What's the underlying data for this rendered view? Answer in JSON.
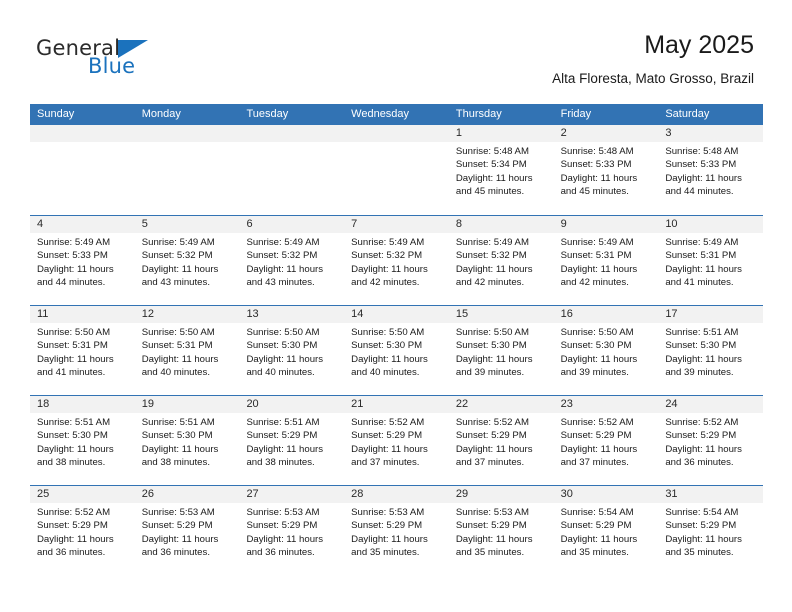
{
  "brand": {
    "word_general": "General",
    "word_blue": "Blue",
    "flag_icon": "triangle-flag-icon",
    "accent_color": "#1b72bd"
  },
  "header": {
    "title": "May 2025",
    "subtitle": "Alta Floresta, Mato Grosso, Brazil"
  },
  "calendar": {
    "header_bg": "#3273b4",
    "daynum_bg": "#f2f2f2",
    "weekday_headers": [
      "Sunday",
      "Monday",
      "Tuesday",
      "Wednesday",
      "Thursday",
      "Friday",
      "Saturday"
    ],
    "weeks": [
      [
        {
          "day": "",
          "empty": true,
          "sunrise": "",
          "sunset": "",
          "daylight_line1": "",
          "daylight_line2": ""
        },
        {
          "day": "",
          "empty": true,
          "sunrise": "",
          "sunset": "",
          "daylight_line1": "",
          "daylight_line2": ""
        },
        {
          "day": "",
          "empty": true,
          "sunrise": "",
          "sunset": "",
          "daylight_line1": "",
          "daylight_line2": ""
        },
        {
          "day": "",
          "empty": true,
          "sunrise": "",
          "sunset": "",
          "daylight_line1": "",
          "daylight_line2": ""
        },
        {
          "day": "1",
          "sunrise": "Sunrise: 5:48 AM",
          "sunset": "Sunset: 5:34 PM",
          "daylight_line1": "Daylight: 11 hours",
          "daylight_line2": "and 45 minutes."
        },
        {
          "day": "2",
          "sunrise": "Sunrise: 5:48 AM",
          "sunset": "Sunset: 5:33 PM",
          "daylight_line1": "Daylight: 11 hours",
          "daylight_line2": "and 45 minutes."
        },
        {
          "day": "3",
          "sunrise": "Sunrise: 5:48 AM",
          "sunset": "Sunset: 5:33 PM",
          "daylight_line1": "Daylight: 11 hours",
          "daylight_line2": "and 44 minutes."
        }
      ],
      [
        {
          "day": "4",
          "sunrise": "Sunrise: 5:49 AM",
          "sunset": "Sunset: 5:33 PM",
          "daylight_line1": "Daylight: 11 hours",
          "daylight_line2": "and 44 minutes."
        },
        {
          "day": "5",
          "sunrise": "Sunrise: 5:49 AM",
          "sunset": "Sunset: 5:32 PM",
          "daylight_line1": "Daylight: 11 hours",
          "daylight_line2": "and 43 minutes."
        },
        {
          "day": "6",
          "sunrise": "Sunrise: 5:49 AM",
          "sunset": "Sunset: 5:32 PM",
          "daylight_line1": "Daylight: 11 hours",
          "daylight_line2": "and 43 minutes."
        },
        {
          "day": "7",
          "sunrise": "Sunrise: 5:49 AM",
          "sunset": "Sunset: 5:32 PM",
          "daylight_line1": "Daylight: 11 hours",
          "daylight_line2": "and 42 minutes."
        },
        {
          "day": "8",
          "sunrise": "Sunrise: 5:49 AM",
          "sunset": "Sunset: 5:32 PM",
          "daylight_line1": "Daylight: 11 hours",
          "daylight_line2": "and 42 minutes."
        },
        {
          "day": "9",
          "sunrise": "Sunrise: 5:49 AM",
          "sunset": "Sunset: 5:31 PM",
          "daylight_line1": "Daylight: 11 hours",
          "daylight_line2": "and 42 minutes."
        },
        {
          "day": "10",
          "sunrise": "Sunrise: 5:49 AM",
          "sunset": "Sunset: 5:31 PM",
          "daylight_line1": "Daylight: 11 hours",
          "daylight_line2": "and 41 minutes."
        }
      ],
      [
        {
          "day": "11",
          "sunrise": "Sunrise: 5:50 AM",
          "sunset": "Sunset: 5:31 PM",
          "daylight_line1": "Daylight: 11 hours",
          "daylight_line2": "and 41 minutes."
        },
        {
          "day": "12",
          "sunrise": "Sunrise: 5:50 AM",
          "sunset": "Sunset: 5:31 PM",
          "daylight_line1": "Daylight: 11 hours",
          "daylight_line2": "and 40 minutes."
        },
        {
          "day": "13",
          "sunrise": "Sunrise: 5:50 AM",
          "sunset": "Sunset: 5:30 PM",
          "daylight_line1": "Daylight: 11 hours",
          "daylight_line2": "and 40 minutes."
        },
        {
          "day": "14",
          "sunrise": "Sunrise: 5:50 AM",
          "sunset": "Sunset: 5:30 PM",
          "daylight_line1": "Daylight: 11 hours",
          "daylight_line2": "and 40 minutes."
        },
        {
          "day": "15",
          "sunrise": "Sunrise: 5:50 AM",
          "sunset": "Sunset: 5:30 PM",
          "daylight_line1": "Daylight: 11 hours",
          "daylight_line2": "and 39 minutes."
        },
        {
          "day": "16",
          "sunrise": "Sunrise: 5:50 AM",
          "sunset": "Sunset: 5:30 PM",
          "daylight_line1": "Daylight: 11 hours",
          "daylight_line2": "and 39 minutes."
        },
        {
          "day": "17",
          "sunrise": "Sunrise: 5:51 AM",
          "sunset": "Sunset: 5:30 PM",
          "daylight_line1": "Daylight: 11 hours",
          "daylight_line2": "and 39 minutes."
        }
      ],
      [
        {
          "day": "18",
          "sunrise": "Sunrise: 5:51 AM",
          "sunset": "Sunset: 5:30 PM",
          "daylight_line1": "Daylight: 11 hours",
          "daylight_line2": "and 38 minutes."
        },
        {
          "day": "19",
          "sunrise": "Sunrise: 5:51 AM",
          "sunset": "Sunset: 5:30 PM",
          "daylight_line1": "Daylight: 11 hours",
          "daylight_line2": "and 38 minutes."
        },
        {
          "day": "20",
          "sunrise": "Sunrise: 5:51 AM",
          "sunset": "Sunset: 5:29 PM",
          "daylight_line1": "Daylight: 11 hours",
          "daylight_line2": "and 38 minutes."
        },
        {
          "day": "21",
          "sunrise": "Sunrise: 5:52 AM",
          "sunset": "Sunset: 5:29 PM",
          "daylight_line1": "Daylight: 11 hours",
          "daylight_line2": "and 37 minutes."
        },
        {
          "day": "22",
          "sunrise": "Sunrise: 5:52 AM",
          "sunset": "Sunset: 5:29 PM",
          "daylight_line1": "Daylight: 11 hours",
          "daylight_line2": "and 37 minutes."
        },
        {
          "day": "23",
          "sunrise": "Sunrise: 5:52 AM",
          "sunset": "Sunset: 5:29 PM",
          "daylight_line1": "Daylight: 11 hours",
          "daylight_line2": "and 37 minutes."
        },
        {
          "day": "24",
          "sunrise": "Sunrise: 5:52 AM",
          "sunset": "Sunset: 5:29 PM",
          "daylight_line1": "Daylight: 11 hours",
          "daylight_line2": "and 36 minutes."
        }
      ],
      [
        {
          "day": "25",
          "sunrise": "Sunrise: 5:52 AM",
          "sunset": "Sunset: 5:29 PM",
          "daylight_line1": "Daylight: 11 hours",
          "daylight_line2": "and 36 minutes."
        },
        {
          "day": "26",
          "sunrise": "Sunrise: 5:53 AM",
          "sunset": "Sunset: 5:29 PM",
          "daylight_line1": "Daylight: 11 hours",
          "daylight_line2": "and 36 minutes."
        },
        {
          "day": "27",
          "sunrise": "Sunrise: 5:53 AM",
          "sunset": "Sunset: 5:29 PM",
          "daylight_line1": "Daylight: 11 hours",
          "daylight_line2": "and 36 minutes."
        },
        {
          "day": "28",
          "sunrise": "Sunrise: 5:53 AM",
          "sunset": "Sunset: 5:29 PM",
          "daylight_line1": "Daylight: 11 hours",
          "daylight_line2": "and 35 minutes."
        },
        {
          "day": "29",
          "sunrise": "Sunrise: 5:53 AM",
          "sunset": "Sunset: 5:29 PM",
          "daylight_line1": "Daylight: 11 hours",
          "daylight_line2": "and 35 minutes."
        },
        {
          "day": "30",
          "sunrise": "Sunrise: 5:54 AM",
          "sunset": "Sunset: 5:29 PM",
          "daylight_line1": "Daylight: 11 hours",
          "daylight_line2": "and 35 minutes."
        },
        {
          "day": "31",
          "sunrise": "Sunrise: 5:54 AM",
          "sunset": "Sunset: 5:29 PM",
          "daylight_line1": "Daylight: 11 hours",
          "daylight_line2": "and 35 minutes."
        }
      ]
    ]
  }
}
